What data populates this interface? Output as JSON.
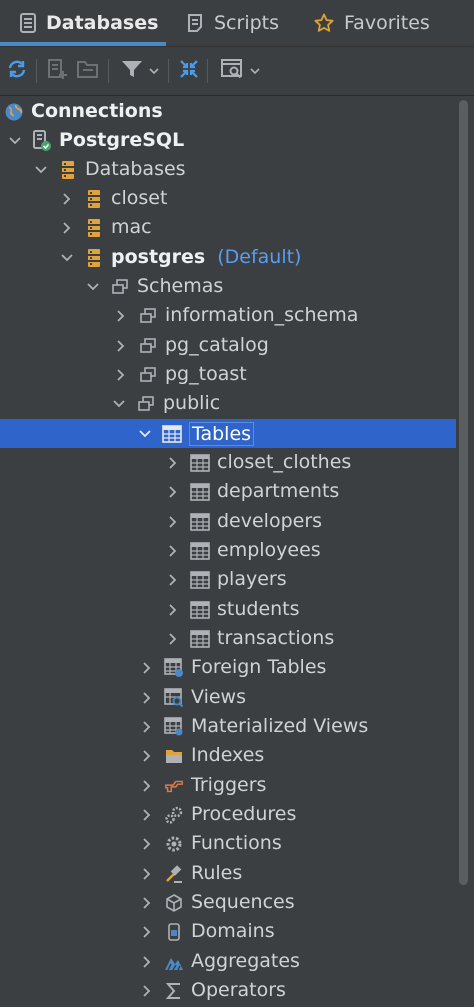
{
  "tabs": {
    "databases": "Databases",
    "scripts": "Scripts",
    "favorites": "Favorites"
  },
  "tree": {
    "connections": "Connections",
    "postgresql": "PostgreSQL",
    "databases": "Databases",
    "closet": "closet",
    "mac": "mac",
    "postgres": "postgres",
    "postgres_tag": "(Default)",
    "schemas": "Schemas",
    "information_schema": "information_schema",
    "pg_catalog": "pg_catalog",
    "pg_toast": "pg_toast",
    "public": "public",
    "tables": "Tables",
    "table_items": [
      "closet_clothes",
      "departments",
      "developers",
      "employees",
      "players",
      "students",
      "transactions"
    ],
    "foreign_tables": "Foreign Tables",
    "views": "Views",
    "materialized_views": "Materialized Views",
    "indexes": "Indexes",
    "triggers": "Triggers",
    "procedures": "Procedures",
    "functions": "Functions",
    "rules": "Rules",
    "sequences": "Sequences",
    "domains": "Domains",
    "aggregates": "Aggregates",
    "operators": "Operators"
  },
  "colors": {
    "background": "#3c3f41",
    "selection": "#2f65ca",
    "accent": "#4a88c7",
    "db_icon": "#e0a23a"
  }
}
